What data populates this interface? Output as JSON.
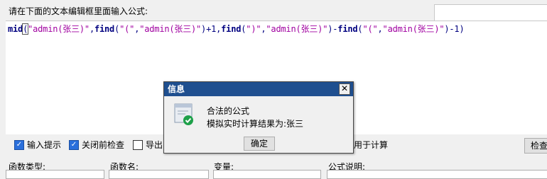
{
  "editor": {
    "prompt": "请在下面的文本编辑框里面输入公式:",
    "formula_parts": [
      {
        "t": "mid",
        "c": "kw"
      },
      {
        "t": "(",
        "c": "pl",
        "boxed": true
      },
      {
        "t": "\"admin(张三)\"",
        "c": "str"
      },
      {
        "t": ",",
        "c": "pl"
      },
      {
        "t": "find",
        "c": "kw"
      },
      {
        "t": "(",
        "c": "pl"
      },
      {
        "t": "\"(\"",
        "c": "str"
      },
      {
        "t": ",",
        "c": "pl"
      },
      {
        "t": "\"admin(张三)\"",
        "c": "str"
      },
      {
        "t": ")+1,",
        "c": "pl"
      },
      {
        "t": "find",
        "c": "kw"
      },
      {
        "t": "(",
        "c": "pl"
      },
      {
        "t": "\")\"",
        "c": "str"
      },
      {
        "t": ",",
        "c": "pl"
      },
      {
        "t": "\"admin(张三)\"",
        "c": "str"
      },
      {
        "t": ")-",
        "c": "pl"
      },
      {
        "t": "find",
        "c": "kw"
      },
      {
        "t": "(",
        "c": "pl"
      },
      {
        "t": "\"(\"",
        "c": "str"
      },
      {
        "t": ",",
        "c": "pl"
      },
      {
        "t": "\"admin(张三)\"",
        "c": "str"
      },
      {
        "t": ")-1)",
        "c": "pl"
      }
    ]
  },
  "options": {
    "input_hint": "输入提示",
    "check_on_close": "关闭前检查",
    "export": "导出",
    "use_for_calc": "式用于计算",
    "check_button": "检查"
  },
  "labels": {
    "func_type": "函数类型:",
    "func_name": "函数名:",
    "variable": "变量:",
    "formula_desc": "公式说明:"
  },
  "dialog": {
    "title": "信息",
    "close": "✕",
    "line1": "合法的公式",
    "line2": "模拟实时计算结果为:张三",
    "ok": "确定"
  },
  "colors": {
    "titlebar": "#1f4f8f",
    "keyword": "#000080",
    "string": "#a000a0",
    "success": "#1ea04a"
  }
}
